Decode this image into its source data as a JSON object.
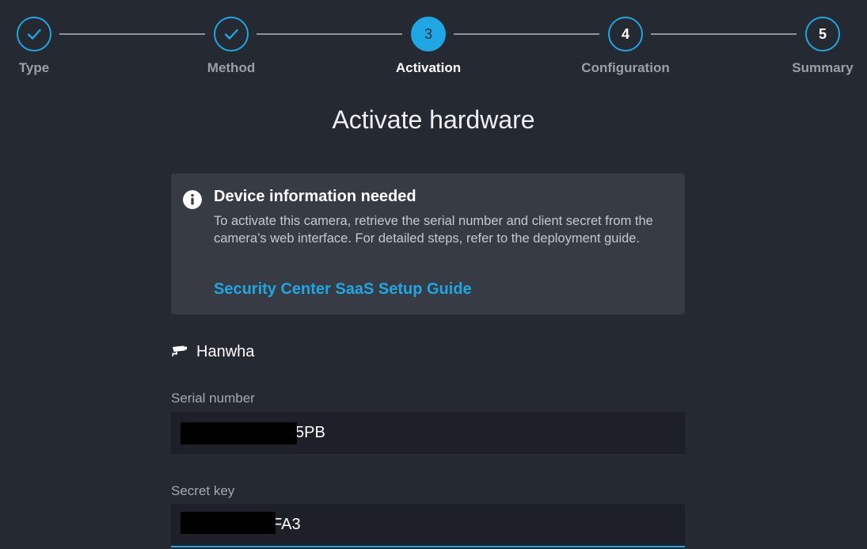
{
  "stepper": {
    "steps": [
      {
        "label": "Type",
        "state": "done",
        "num": ""
      },
      {
        "label": "Method",
        "state": "done",
        "num": ""
      },
      {
        "label": "Activation",
        "state": "active",
        "num": "3"
      },
      {
        "label": "Configuration",
        "state": "pending",
        "num": "4"
      },
      {
        "label": "Summary",
        "state": "pending",
        "num": "5"
      }
    ]
  },
  "page": {
    "title": "Activate hardware"
  },
  "notice": {
    "icon": "info-icon",
    "heading": "Device information needed",
    "body": "To activate this camera, retrieve the serial number and client secret from the camera’s web interface. For detailed steps, refer to the deployment guide.",
    "link": "Security Center SaaS Setup Guide"
  },
  "device": {
    "icon": "camera-icon",
    "vendor": "Hanwha"
  },
  "form": {
    "serial_label": "Serial number",
    "serial_value_visible": "5PB",
    "secret_label": "Secret key",
    "secret_value_visible": "FA3"
  },
  "colors": {
    "accent": "#1ea7e2",
    "background": "#252932",
    "panel": "#363b44"
  }
}
